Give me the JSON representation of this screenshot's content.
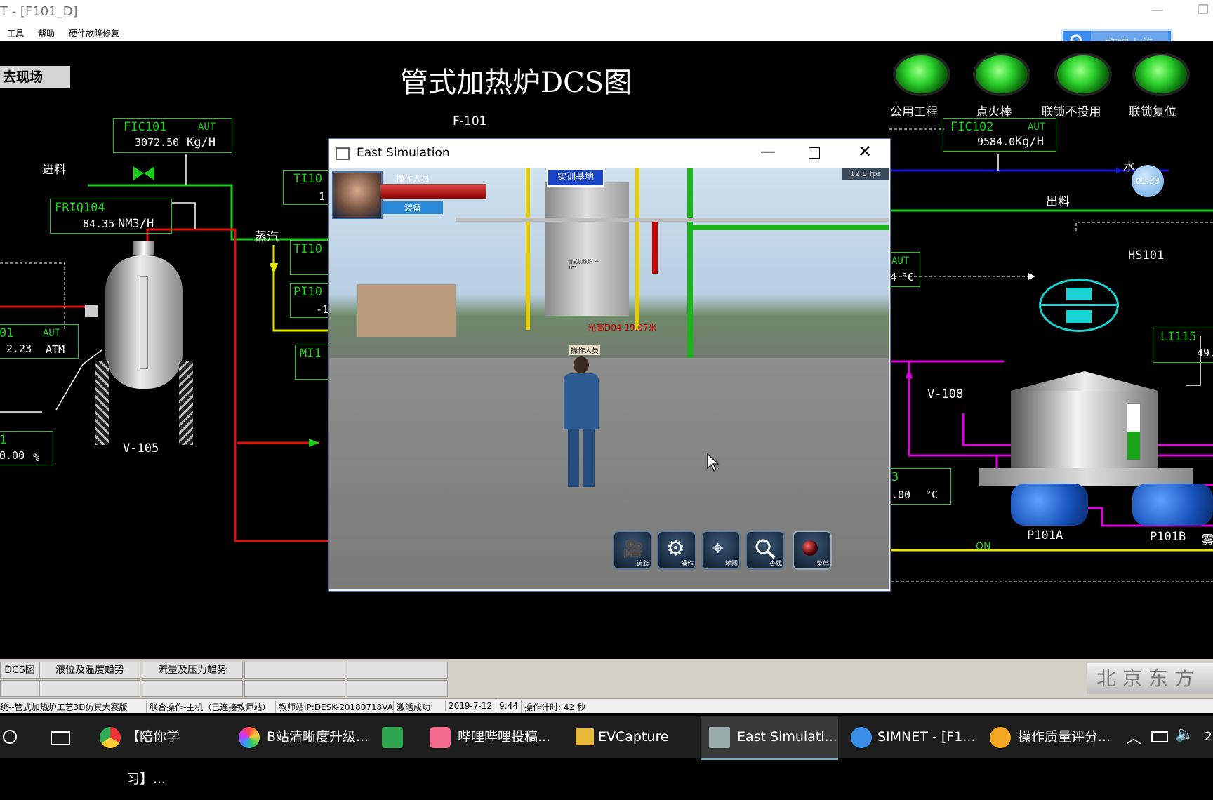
{
  "window": {
    "title": "T - [F101_D]"
  },
  "menu": [
    "工具",
    "帮助",
    "硬件故障修复"
  ],
  "upload_label": "拖拽上传",
  "dcs": {
    "goto_site": "去现场",
    "title": "管式加热炉DCS图",
    "lamps": [
      "公用工程",
      "点火棒",
      "联锁不投用",
      "联锁复位"
    ],
    "fic101": {
      "tag": "FIC101",
      "mode": "AUT",
      "value": "3072.50",
      "unit": "Kg/H"
    },
    "friq104": {
      "tag": "FRIQ104",
      "value": "84.35",
      "unit": "NM3/H"
    },
    "fic102": {
      "tag": "FIC102",
      "mode": "AUT",
      "value": "9584.0",
      "unit": "Kg/H"
    },
    "pressure_box": {
      "tag": "01",
      "mode": "AUT",
      "value": "2.23",
      "unit": "ATM"
    },
    "level_box": {
      "tag": "1",
      "value": "0.00",
      "unit": "%"
    },
    "li115": {
      "tag": "LI115",
      "value": "49."
    },
    "temp_right_top": {
      "mode": "AUT",
      "value": "4",
      "unit": "°C"
    },
    "temp_right_bottom": {
      "tag": "3",
      "value": ".00",
      "unit": "°C"
    },
    "partials": [
      "TI10",
      "1",
      "TI10",
      "PI10",
      "-1",
      "MI1"
    ],
    "labels": {
      "feed": "进料",
      "steam": "蒸汽",
      "water": "水",
      "discharge": "出料",
      "f101": "F-101",
      "hs101": "HS101",
      "v105": "V-105",
      "v108": "V-108",
      "p101a": "P101A",
      "p101b": "P101B",
      "p101b_extra": "雾",
      "on": "ON",
      "timer": "01:33"
    },
    "watermark": "北 京 东 方"
  },
  "sim_window": {
    "title": "East Simulation",
    "fps": "12.8 fps",
    "operator_label": "操作人员",
    "equip_label": "装备",
    "base_label": "实训基地",
    "marker_text": "光高D04  19.07米",
    "character_tag": "操作人员",
    "furnace_label": "管式加热炉 F-101",
    "tools": [
      {
        "icon": "camera-icon",
        "label": "追踪"
      },
      {
        "icon": "gear-icon",
        "label": "操作"
      },
      {
        "icon": "map-pin-icon",
        "label": "地图"
      },
      {
        "icon": "search-icon",
        "label": "查找"
      },
      {
        "icon": "menu-icon",
        "label": "菜单"
      }
    ]
  },
  "tabs_row1": [
    "DCS图",
    "液位及温度趋势",
    "流量及压力趋势",
    "",
    ""
  ],
  "tabs_row2": [
    "",
    "",
    "",
    "",
    ""
  ],
  "status": [
    "统--管式加热炉工艺3D仿真大赛版",
    "联合操作-主机（已连接教师站）",
    "教师站IP:DESK-20180718VA",
    "激活成功!",
    "2019-7-12",
    "9:44",
    "操作计时: 42 秒"
  ],
  "taskbar": {
    "items": [
      "【陪你学习】...",
      "B站清晰度升级...",
      "",
      "哔哩哔哩投稿...",
      "EVCapture",
      "East Simulati...",
      "SIMNET - [F1...",
      "操作质量评分..."
    ],
    "clock": "2"
  }
}
